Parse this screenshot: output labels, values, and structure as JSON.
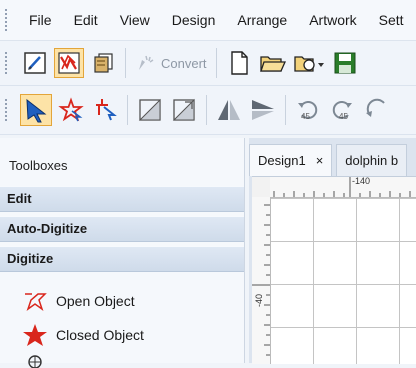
{
  "menu": {
    "items": [
      "File",
      "Edit",
      "View",
      "Design",
      "Arrange",
      "Artwork",
      "Sett"
    ]
  },
  "toolbar1": {
    "convert_label": "Convert",
    "icons": [
      "pen-draw-icon",
      "redwork-icon",
      "stack-layers-icon",
      "convert-icon",
      "new-file-icon",
      "open-folder-icon",
      "open-dropdown-icon",
      "save-icon"
    ]
  },
  "toolbar2": {
    "icons": [
      "select-arrow-icon",
      "point-edit-icon",
      "reshape-icon",
      "flip-vertical-icon",
      "flip-horizontal-icon",
      "mirror-vertical-icon",
      "mirror-horizontal-icon",
      "rotate-left-45-icon",
      "rotate-right-45-icon",
      "rotate-free-icon"
    ],
    "rotate_label_1": "45",
    "rotate_label_2": "45"
  },
  "panel": {
    "title": "Toolboxes",
    "sections": [
      "Edit",
      "Auto-Digitize",
      "Digitize"
    ],
    "tools": [
      {
        "label": "Open Object",
        "icon": "open-object-icon"
      },
      {
        "label": "Closed Object",
        "icon": "closed-object-icon"
      },
      {
        "label": "",
        "icon": "circle-tool-icon"
      }
    ]
  },
  "document": {
    "tabs": [
      {
        "label": "Design1",
        "close": "×"
      },
      {
        "label": "dolphin b"
      }
    ],
    "ruler_top_label": "-140",
    "ruler_left_label": "-40"
  },
  "colors": {
    "accent_active": "#fde3a7",
    "section_bg": "#d6e1ee",
    "closed_object_red": "#d9261c"
  }
}
